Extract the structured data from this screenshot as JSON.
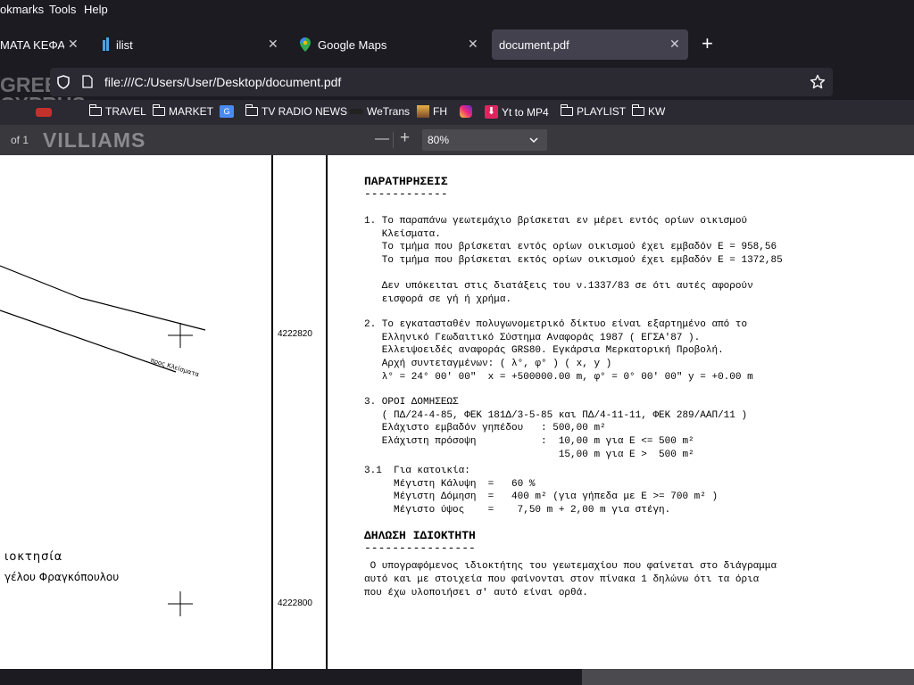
{
  "menu": {
    "bookmarks": "okmarks",
    "tools": "Tools",
    "help": "Help"
  },
  "tabs": [
    {
      "label": "ΜΑΤΑ ΚΕΦΑΛ",
      "close": "✕"
    },
    {
      "label": "ilist",
      "close": "✕"
    },
    {
      "label": "Google Maps",
      "close": "✕"
    },
    {
      "label": "document.pdf",
      "close": "✕"
    }
  ],
  "new_tab": "+",
  "url": "file:///C:/Users/User/Desktop/document.pdf",
  "watermark": {
    "line1": "GREECE &",
    "line2": "CYPRUS",
    "line3": "VILLIAMS"
  },
  "bookmarks": [
    {
      "label": "TRAVEL",
      "icon": "folder-icon"
    },
    {
      "label": "MARKET",
      "icon": "folder-icon"
    },
    {
      "label": "",
      "icon": "translate-icon"
    },
    {
      "label": "TV RADIO NEWS",
      "icon": "folder-icon"
    },
    {
      "label": "WeTrans",
      "icon": "wetransfer-icon"
    },
    {
      "label": "FH",
      "icon": "fh-icon"
    },
    {
      "label": "",
      "icon": "instagram-icon"
    },
    {
      "label": "Yt to MP4",
      "icon": "download-icon"
    },
    {
      "label": "PLAYLIST",
      "icon": "folder-icon"
    },
    {
      "label": "KW",
      "icon": "folder-icon"
    }
  ],
  "pdf_toolbar": {
    "page_of": "of 1",
    "zoom_out": "—",
    "zoom_in": "+",
    "zoom": "80%"
  },
  "map": {
    "road_label": "προς Κλείσματα",
    "coord_top": "4222820",
    "coord_bottom": "4222800",
    "owner_label": "ιοκτησία",
    "owner_name": "γέλου Φραγκόπουλου"
  },
  "doc": {
    "heading1": "ΠΑΡΑΤΗΡΗΣΕΙΣ",
    "underline1": "------------",
    "p1": [
      "1. Το παραπάνω γεωτεμάχιο βρίσκεται εν μέρει εντός ορίων οικισμού",
      "   Κλείσματα.",
      "   Το τμήμα που βρίσκεται εντός ορίων οικισμού έχει εμβαδόν Ε = 958,56",
      "   Το τμήμα που βρίσκεται εκτός ορίων οικισμού έχει εμβαδόν Ε = 1372,85",
      "",
      "   Δεν υπόκειται στις διατάξεις του ν.1337/83 σε ότι αυτές αφορούν",
      "   εισφορά σε γή ή χρήμα."
    ],
    "p2": [
      "2. Το εγκατασταθέν πολυγωνομετρικό δίκτυο είναι εξαρτημένο από το",
      "   Ελληνικό Γεωδαιτικό Σύστημα Αναφοράς 1987 ( ΕΓΣΑ'87 ).",
      "   Ελλειψοειδές αναφοράς GRS80. Εγκάρσια Μερκατορική Προβολή.",
      "   Αρχή συντεταγμένων: ( λ°, φ° ) ( x, y )",
      "   λ° = 24° 00' 00\"  x = +500000.00 m, φ° = 0° 00' 00\" y = +0.00 m"
    ],
    "p3": [
      "3. ΟΡΟΙ ΔΟΜΗΣΕΩΣ",
      "   ( ΠΔ/24-4-85, ΦΕΚ 181Δ/3-5-85 και ΠΔ/4-11-11, ΦΕΚ 289/ΑΑΠ/11 )",
      "   Ελάχιστο εμβαδόν γηπέδου   : 500,00 m²",
      "   Ελάχιστη πρόσοψη           :  10,00 m για Ε <= 500 m²",
      "                                 15,00 m για Ε >  500 m²"
    ],
    "p31": [
      "3.1  Για κατοικία:",
      "     Μέγιστη Κάλυψη  =   60 %",
      "     Μέγιστη Δόμηση  =   400 m² (για γήπεδα με Ε >= 700 m² )",
      "     Μέγιστο ύψος    =    7,50 m + 2,00 m για στέγη."
    ],
    "heading2": "ΔΗΛΩΣΗ ΙΔΙΟΚΤΗΤΗ",
    "underline2": "----------------",
    "p4": [
      " Ο υπογραφόμενος ιδιοκτήτης του γεωτεμαχίου που φαίνεται στο διάγραμμα",
      "αυτό και με στοιχεία που φαίνονται στον πίνακα 1 δηλώνω ότι τα όρια",
      "που έχω υλοποιήσει σ' αυτό είναι ορθά."
    ]
  }
}
